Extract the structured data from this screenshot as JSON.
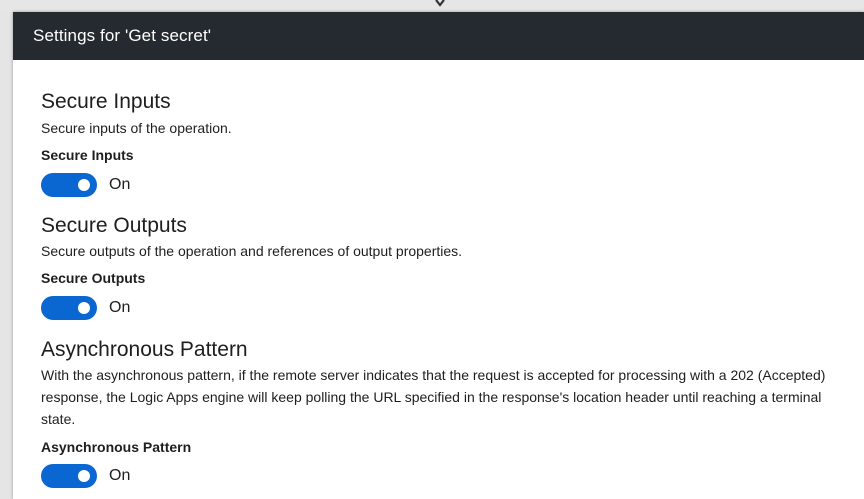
{
  "dialog": {
    "title": "Settings for 'Get secret'"
  },
  "sections": {
    "secure_inputs": {
      "title": "Secure Inputs",
      "description": "Secure inputs of the operation.",
      "field_label": "Secure Inputs",
      "toggle_state": "On"
    },
    "secure_outputs": {
      "title": "Secure Outputs",
      "description": "Secure outputs of the operation and references of output properties.",
      "field_label": "Secure Outputs",
      "toggle_state": "On"
    },
    "async_pattern": {
      "title": "Asynchronous Pattern",
      "description": "With the asynchronous pattern, if the remote server indicates that the request is accepted for processing with a 202 (Accepted) response, the Logic Apps engine will keep polling the URL specified in the response's location header until reaching a terminal state.",
      "field_label": "Asynchronous Pattern",
      "toggle_state": "On"
    }
  },
  "colors": {
    "header_bg": "#252a30",
    "toggle_on": "#0a66d1"
  },
  "icons": {
    "connector": "down-arrow-icon"
  }
}
